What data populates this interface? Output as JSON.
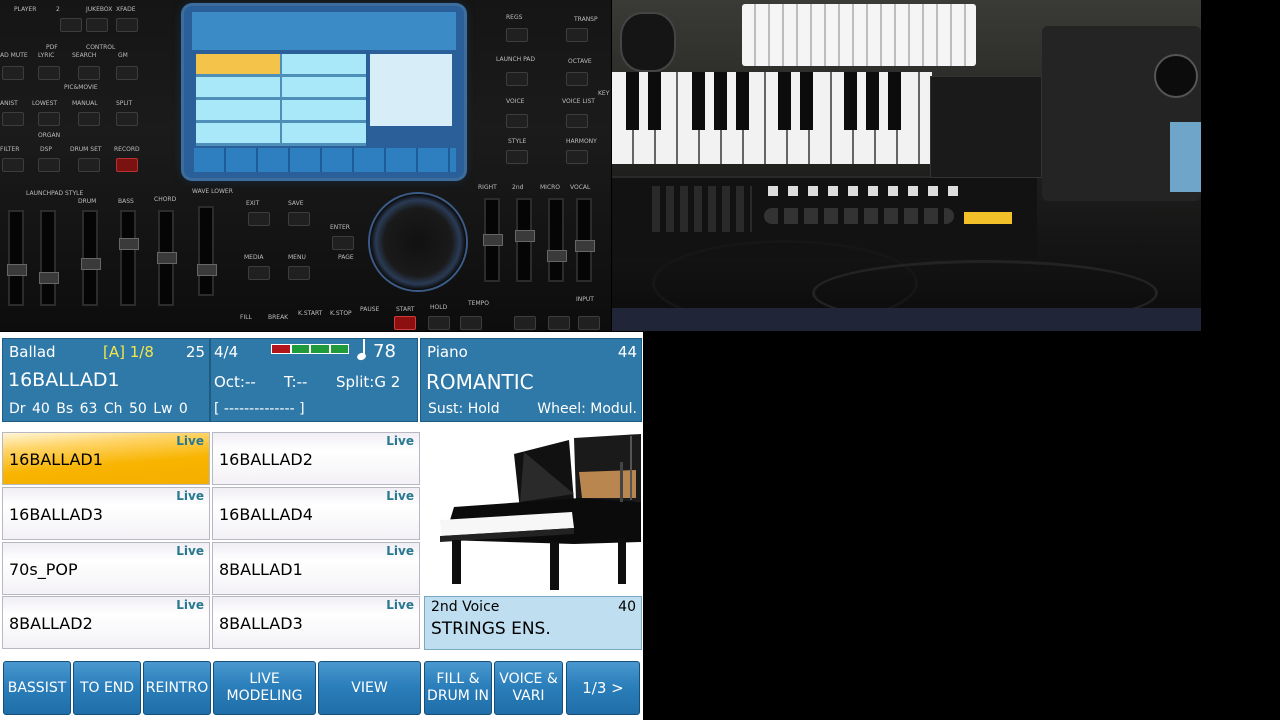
{
  "left_photo": {
    "panel_labels": [
      "PLAYER",
      "2",
      "JUKEBOX",
      "XFADE",
      "REGS",
      "TRANSP",
      "AD MUTE",
      "LYRIC",
      "SEARCH",
      "GM",
      "PDF",
      "CONTROL",
      "PIC&MOVIE",
      "LAUNCH PAD",
      "OCTAVE",
      "ANIST",
      "LOWEST",
      "MANUAL",
      "SPLIT",
      "VOICE",
      "VOICE LIST",
      "KEY",
      "ORGAN",
      "FILTER",
      "DSP",
      "DRUM SET",
      "RECORD",
      "STYLE",
      "HARMONY",
      "LAUNCHPAD STYLE",
      "DRUM",
      "BASS",
      "CHORD",
      "WAVE LOWER",
      "EXIT",
      "SAVE",
      "ENTER",
      "PAGE",
      "MEDIA",
      "MENU",
      "RIGHT",
      "2nd",
      "MICRO",
      "VOCAL",
      "FILL",
      "BREAK",
      "K.START",
      "K.STOP",
      "PAUSE",
      "START",
      "HOLD",
      "TEMPO",
      "INPUT"
    ]
  },
  "style_panel": {
    "category": "Ballad",
    "variation": "[A] 1/8",
    "number": "25",
    "name": "16BALLAD1",
    "tracks": "Dr 40   Bs 63   Ch 50   Lw 0"
  },
  "mid_panel": {
    "time_sig": "4/4",
    "tempo": "78",
    "octave": "Oct:--",
    "transpose": "T:--",
    "split": "Split:G 2",
    "chord": "[ -------------- ]"
  },
  "voice_panel": {
    "category": "Piano",
    "number": "44",
    "name": "ROMANTIC",
    "sustain": "Sust: Hold",
    "wheel": "Wheel: Modul."
  },
  "styles": [
    {
      "name": "16BALLAD1",
      "tag": "Live",
      "selected": true
    },
    {
      "name": "16BALLAD2",
      "tag": "Live",
      "selected": false
    },
    {
      "name": "16BALLAD3",
      "tag": "Live",
      "selected": false
    },
    {
      "name": "16BALLAD4",
      "tag": "Live",
      "selected": false
    },
    {
      "name": "70s_POP",
      "tag": "Live",
      "selected": false
    },
    {
      "name": "8BALLAD1",
      "tag": "Live",
      "selected": false
    },
    {
      "name": "8BALLAD2",
      "tag": "Live",
      "selected": false
    },
    {
      "name": "8BALLAD3",
      "tag": "Live",
      "selected": false
    }
  ],
  "second_voice": {
    "label": "2nd Voice",
    "number": "40",
    "name": "STRINGS ENS."
  },
  "buttons": [
    "BASSIST",
    "TO END",
    "REINTRO",
    "LIVE\nMODELING",
    "VIEW",
    "FILL &\nDRUM IN",
    "VOICE &\nVARI",
    "1/3 >"
  ],
  "colors": {
    "accent": "#2f79a9",
    "selected": "#f8b400",
    "live_tag": "#28788f",
    "signal": [
      "#b3151c",
      "#1f9b3b",
      "#1f9b3b",
      "#1f9b3b"
    ]
  }
}
